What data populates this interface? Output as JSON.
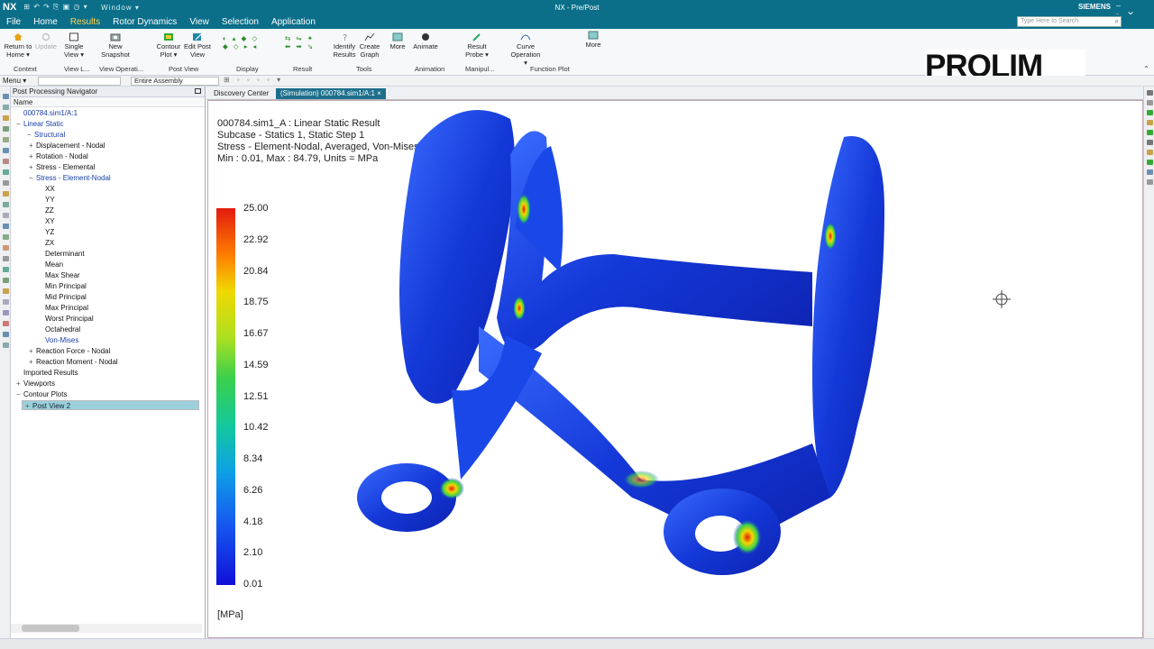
{
  "titlebar": {
    "app": "NX",
    "window_menu": "Window ▾",
    "title": "NX - Pre/Post",
    "brand": "SIEMENS",
    "search_placeholder": "Type Here to Search"
  },
  "menu": [
    "File",
    "Home",
    "Results",
    "Rotor Dynamics",
    "View",
    "Selection",
    "Application"
  ],
  "menu_active": "Results",
  "ribbon": {
    "buttons": [
      {
        "label": "Return to Home ▾",
        "icon": "return-home-icon"
      },
      {
        "label": "Update",
        "icon": "update-icon"
      },
      {
        "label": "Single View ▾",
        "icon": "single-view-icon"
      },
      {
        "label": "New Snapshot",
        "icon": "snapshot-icon"
      },
      {
        "label": "Contour Plot ▾",
        "icon": "contour-plot-icon"
      },
      {
        "label": "Edit Post View",
        "icon": "edit-post-view-icon"
      },
      {
        "label": "Identify Results",
        "icon": "identify-icon"
      },
      {
        "label": "Create Graph",
        "icon": "graph-icon"
      },
      {
        "label": "More",
        "icon": "more-icon"
      },
      {
        "label": "Animate",
        "icon": "animate-icon"
      },
      {
        "label": "Result Probe ▾",
        "icon": "probe-icon"
      },
      {
        "label": "Curve Operation ▾",
        "icon": "curve-icon"
      },
      {
        "label": "More",
        "icon": "more-icon"
      }
    ],
    "groups": [
      "Context",
      "View L...",
      "View Operati...",
      "Post View",
      "Display",
      "Result",
      "Tools",
      "Animation",
      "Manipul...",
      "Function Plot"
    ]
  },
  "logo": "PROLIM",
  "selection_bar": {
    "menu_label": "Menu ▾",
    "filter_value": "",
    "scope_value": "Entire Assembly"
  },
  "navigator": {
    "title": "Post Processing Navigator",
    "column": "Name",
    "nodes": [
      {
        "label": "000784.sim1/A:1",
        "x": 4,
        "blue": true,
        "twist": ""
      },
      {
        "label": "Linear Static",
        "x": 4,
        "blue": true,
        "twist": "−"
      },
      {
        "label": "Structural",
        "x": 16,
        "blue": true,
        "twist": "−"
      },
      {
        "label": "Displacement - Nodal",
        "x": 18,
        "blue": false,
        "twist": "+"
      },
      {
        "label": "Rotation - Nodal",
        "x": 18,
        "blue": false,
        "twist": "+"
      },
      {
        "label": "Stress - Elemental",
        "x": 18,
        "blue": false,
        "twist": "+"
      },
      {
        "label": "Stress - Element-Nodal",
        "x": 18,
        "blue": true,
        "twist": "−"
      },
      {
        "label": "XX",
        "x": 28,
        "blue": false,
        "twist": ""
      },
      {
        "label": "YY",
        "x": 28,
        "blue": false,
        "twist": ""
      },
      {
        "label": "ZZ",
        "x": 28,
        "blue": false,
        "twist": ""
      },
      {
        "label": "XY",
        "x": 28,
        "blue": false,
        "twist": ""
      },
      {
        "label": "YZ",
        "x": 28,
        "blue": false,
        "twist": ""
      },
      {
        "label": "ZX",
        "x": 28,
        "blue": false,
        "twist": ""
      },
      {
        "label": "Determinant",
        "x": 28,
        "blue": false,
        "twist": ""
      },
      {
        "label": "Mean",
        "x": 28,
        "blue": false,
        "twist": ""
      },
      {
        "label": "Max Shear",
        "x": 28,
        "blue": false,
        "twist": ""
      },
      {
        "label": "Min Principal",
        "x": 28,
        "blue": false,
        "twist": ""
      },
      {
        "label": "Mid Principal",
        "x": 28,
        "blue": false,
        "twist": ""
      },
      {
        "label": "Max Principal",
        "x": 28,
        "blue": false,
        "twist": ""
      },
      {
        "label": "Worst Principal",
        "x": 28,
        "blue": false,
        "twist": ""
      },
      {
        "label": "Octahedral",
        "x": 28,
        "blue": false,
        "twist": ""
      },
      {
        "label": "Von-Mises",
        "x": 28,
        "blue": true,
        "twist": ""
      },
      {
        "label": "Reaction Force - Nodal",
        "x": 18,
        "blue": false,
        "twist": "+"
      },
      {
        "label": "Reaction Moment - Nodal",
        "x": 18,
        "blue": false,
        "twist": "+"
      },
      {
        "label": "Imported Results",
        "x": 4,
        "blue": false,
        "twist": ""
      },
      {
        "label": "Viewports",
        "x": 4,
        "blue": false,
        "twist": "+"
      },
      {
        "label": "Contour Plots",
        "x": 4,
        "blue": false,
        "twist": "−"
      },
      {
        "label": "Post View 2",
        "x": 10,
        "blue": true,
        "twist": "+",
        "selected": true
      }
    ]
  },
  "tabs": [
    {
      "label": "Discovery Center",
      "active": false
    },
    {
      "label": "(Simulation) 000784.sim1/A:1 ×",
      "active": true
    }
  ],
  "result_info": {
    "line1": "000784.sim1_A : Linear Static Result",
    "line2": "Subcase - Statics 1, Static Step 1",
    "line3": "Stress - Element-Nodal, Averaged, Von-Mises",
    "line4": "Min : 0.01, Max : 84.79, Units = MPa"
  },
  "legend": {
    "labels": [
      "25.00",
      "22.92",
      "20.84",
      "18.75",
      "16.67",
      "14.59",
      "12.51",
      "10.42",
      "8.34",
      "6.26",
      "4.18",
      "2.10",
      "0.01"
    ],
    "unit": "[MPa]",
    "colors": [
      "#e31b0e",
      "#ff7a00",
      "#f0d800",
      "#3bd04a",
      "#0ea0e6",
      "#1010d8"
    ]
  },
  "colors": {
    "title_bar": "#0b6f8a",
    "active_menu": "#ffd24d",
    "model_blue": "#1438d8",
    "selected_row": "#9bd0dc"
  }
}
